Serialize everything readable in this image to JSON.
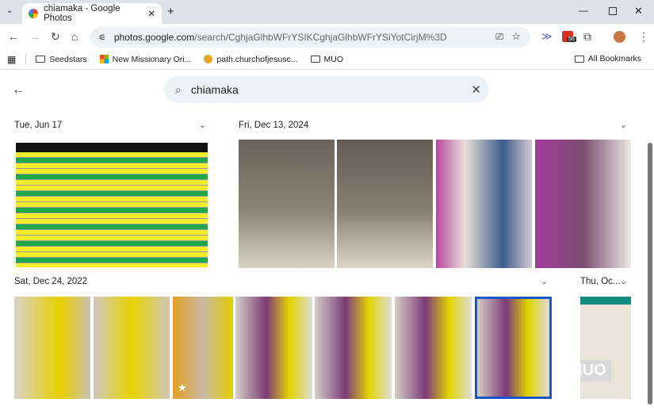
{
  "browser": {
    "tab_title": "chiamaka - Google Photos",
    "url_domain": "photos.google.com",
    "url_path": "/search/CghjaGlhbWFrYSIKCghjaGlhbWFrYSiYotCirjM%3D",
    "extension_badge": "56",
    "bookmarks": [
      {
        "label": "Seedstars"
      },
      {
        "label": "New Missionary Ori..."
      },
      {
        "label": "path.churchofjesusc..."
      },
      {
        "label": "MUO"
      }
    ],
    "all_bookmarks": "All Bookmarks"
  },
  "search": {
    "query": "chiamaka"
  },
  "groups": [
    {
      "date": "Tue, Jun 17"
    },
    {
      "date": "Fri, Dec 13, 2024"
    },
    {
      "date": "Sat, Dec 24, 2022"
    },
    {
      "date": "Thu, Oc..."
    }
  ],
  "watermark": "MUO"
}
